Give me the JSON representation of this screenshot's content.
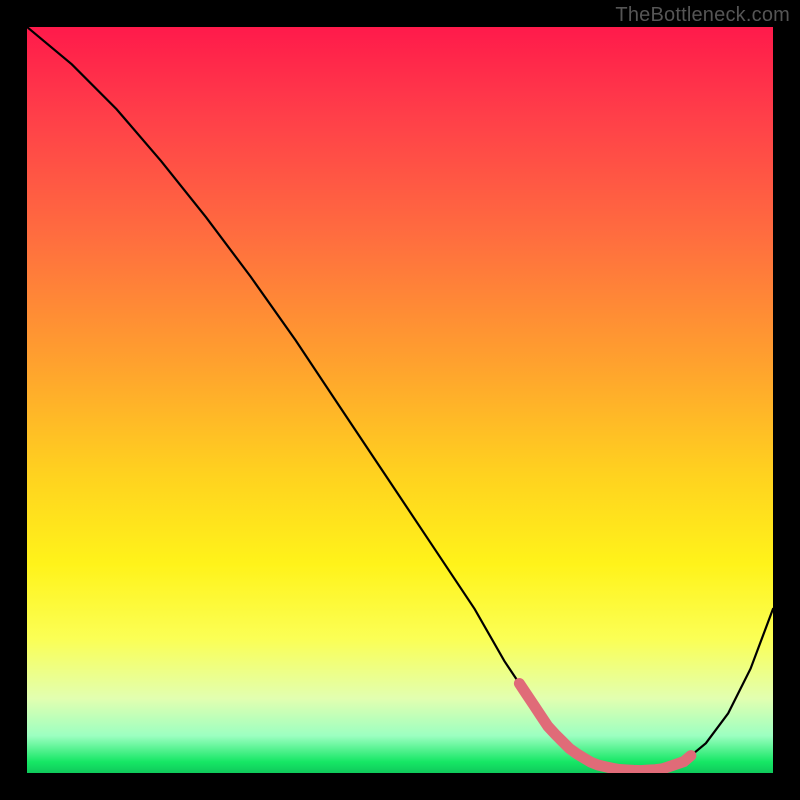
{
  "attribution": "TheBottleneck.com",
  "chart_data": {
    "type": "line",
    "title": "",
    "xlabel": "",
    "ylabel": "",
    "xlim": [
      0,
      100
    ],
    "ylim": [
      0,
      100
    ],
    "series": [
      {
        "name": "bottleneck-curve",
        "x": [
          0,
          6,
          12,
          18,
          24,
          30,
          36,
          42,
          48,
          54,
          60,
          64,
          68,
          70,
          73,
          76,
          79,
          82,
          85,
          88,
          91,
          94,
          97,
          100
        ],
        "y": [
          100,
          95,
          89,
          82,
          74.5,
          66.5,
          58,
          49,
          40,
          31,
          22,
          15,
          9,
          6,
          3,
          1.2,
          0.5,
          0.3,
          0.5,
          1.5,
          4,
          8,
          14,
          22
        ]
      }
    ],
    "optimal_range": {
      "x_start": 66,
      "x_end": 89
    },
    "colors": {
      "curve": "#000000",
      "markers": "#e06b78",
      "gradient_top": "#ff1a4b",
      "gradient_bottom": "#0fc95b",
      "page_background": "#000000"
    }
  }
}
